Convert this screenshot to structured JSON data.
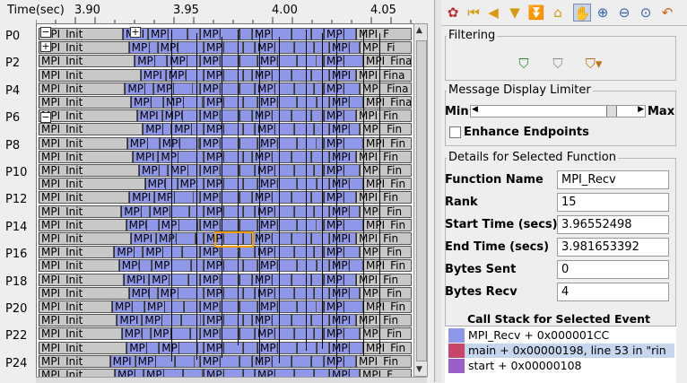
{
  "timeline": {
    "axis_title": "Time(sec)",
    "ticks": [
      "3.90",
      "3.95",
      "4.00",
      "4.05"
    ],
    "rank_labels": [
      "P0",
      "P2",
      "P4",
      "P6",
      "P8",
      "P10",
      "P12",
      "P14",
      "P16",
      "P18",
      "P20",
      "P22",
      "P24"
    ],
    "selected_label": "MPI_I",
    "rows": [
      [
        "MPI_Init",
        "MPI",
        "MPI",
        "MPI",
        "MPI",
        "MPI",
        "MPI_F"
      ],
      [
        "MPI_Init",
        "MP",
        "MPI",
        "MPI",
        "MPI",
        "MPI",
        "MPI_Fi"
      ],
      [
        "MPI_Init",
        "MP",
        "MP",
        "MPI",
        "MPI",
        "MPI",
        "MPI_Fina"
      ],
      [
        "MPI_Init",
        "MPI_",
        "MPI",
        "MPI",
        "MPI",
        "MPI",
        "MPI_Fina"
      ],
      [
        "MPI_Init",
        "MPI_F",
        "MP",
        "MPI",
        "MPI",
        "MPI",
        "MPI_Fina"
      ],
      [
        "MPI_Init",
        "MPI_",
        "MP",
        "MPI",
        "MPI",
        "MPI",
        "MPI_Fina"
      ],
      [
        "MPI_Init",
        "MPI_",
        "MPI",
        "MPI",
        "MPI",
        "MPI",
        "MPI_Fin"
      ],
      [
        "MPI_Init",
        "MPI_R",
        "MP",
        "MPI",
        "MPI",
        "MPI",
        "MPI_Fin"
      ],
      [
        "MPI_Init",
        "MP",
        "MPI",
        "MPI",
        "MPI",
        "MPI",
        "MPI_Fin"
      ],
      [
        "MPI_Init",
        "MPI_R",
        "MP",
        "MPI",
        "MPI",
        "MPI",
        "MPI_Fin"
      ],
      [
        "MPI_Init",
        "MPI_Re",
        "MP",
        "MPI",
        "MPI",
        "MPI",
        "MPI_Fin"
      ],
      [
        "MPI_Init",
        "MPI_R",
        "MP",
        "MPI",
        "MPI",
        "MPI",
        "MPI_Fin"
      ],
      [
        "MPI_Init",
        "MPI_Re",
        "MP",
        "MPI",
        "MPI",
        "MPI",
        "MPI_Fin"
      ],
      [
        "MPI_Init",
        "MPI_Re",
        "MPI",
        "MPI",
        "MPI_R",
        "MPI",
        "MPI_Fin"
      ],
      [
        "MPI_Init",
        "MPI_Re",
        "MP",
        "MPI",
        "MPI",
        "MPI",
        "MPI_Fin"
      ],
      [
        "MPI_Init",
        "MPI_Re",
        "MPI",
        "MPI_I",
        "MPI",
        "MPI",
        "MPI_Fin"
      ],
      [
        "MPI_Init",
        "MPI_Recv",
        "MP",
        "MPI",
        "MPI",
        "MPI",
        "MPI_Fin"
      ],
      [
        "MPI_Init",
        "MPI_Re",
        "MP",
        "MPI",
        "MPI",
        "MPI",
        "MPI_Fin"
      ],
      [
        "MPI_Init",
        "MPI_Re",
        "MP",
        "MPI",
        "MPI",
        "MPI",
        "MPI_Fin"
      ],
      [
        "MPI_Init",
        "MPI_Recv",
        "MP",
        "MPI",
        "MPI",
        "MPI",
        "MPI_Fin"
      ],
      [
        "MPI_Init",
        "MPI_Re",
        "MP",
        "MPI",
        "MPI",
        "MPI",
        "MPI_Fin"
      ],
      [
        "MPI_Init",
        "MPI_Recv",
        "MP",
        "MPI",
        "MPI",
        "MPI",
        "MPI_Fin"
      ],
      [
        "MPI_Init",
        "MPI_Rec",
        "MP",
        "MPI",
        "MPI",
        "MPI",
        "MPI_Fin"
      ],
      [
        "MPI_Init",
        "MPI_Rec",
        "MP",
        "MPI",
        "MPI",
        "MPI",
        "MPI_Fin"
      ],
      [
        "MPI_Init",
        "MPI_Re",
        "MP",
        "MPI",
        "MPI",
        "MPI",
        "MPI_Fin"
      ],
      [
        "MPI_Init",
        "MPI_Re",
        "MP",
        "MPI",
        "MPI",
        "MPI",
        "MPI_F"
      ]
    ]
  },
  "toolbar": {
    "icons": [
      "palette-icon",
      "first-icon",
      "prev-icon",
      "next-icon",
      "last-icon",
      "up-icon",
      "filter-icon",
      "hand-icon",
      "zoom-in-icon",
      "zoom-out-icon",
      "zoom-reset-icon",
      "undo-icon"
    ]
  },
  "filtering": {
    "title": "Filtering"
  },
  "limiter": {
    "title": "Message Display Limiter",
    "min_label": "Min",
    "max_label": "Max",
    "slider_value": 0.88,
    "checkbox_label": "Enhance Endpoints",
    "checkbox_checked": false
  },
  "details": {
    "title": "Details for Selected Function",
    "fields": [
      {
        "label": "Function Name",
        "value": "MPI_Recv"
      },
      {
        "label": "Rank",
        "value": "15"
      },
      {
        "label": "Start Time (secs)",
        "value": "3.96552498"
      },
      {
        "label": "End Time (secs)",
        "value": "3.981653392"
      },
      {
        "label": "Bytes Sent",
        "value": "0"
      },
      {
        "label": "Bytes Recv",
        "value": "4"
      }
    ]
  },
  "call_stack": {
    "title": "Call Stack for Selected Event",
    "entries": [
      {
        "text": "MPI_Recv + 0x000001CC",
        "color": "#8f98e8"
      },
      {
        "text": "main + 0x00000198, line 53 in \"rin",
        "color": "#c8456a"
      },
      {
        "text": "start + 0x00000108",
        "color": "#9a5fc8"
      }
    ]
  }
}
